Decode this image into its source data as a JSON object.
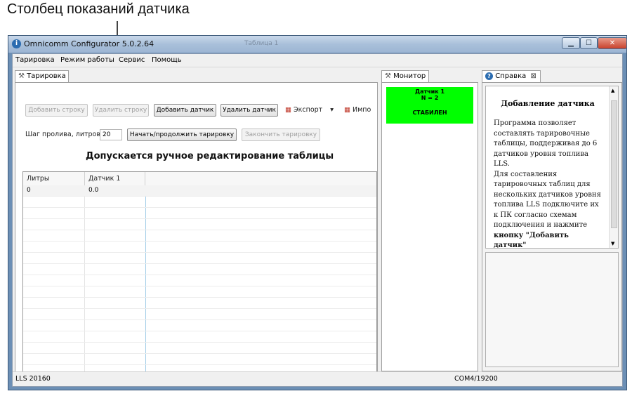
{
  "callout": "Столбец показаний датчика",
  "window": {
    "title": "Omnicomm Configurator 5.0.2.64",
    "ghost_title": "Таблица 1"
  },
  "menu": [
    "Тарировка",
    "Режим работы",
    "Сервис",
    "Помощь"
  ],
  "tarir_tab": "Тарировка",
  "toolbar": {
    "add_row": "Добавить строку",
    "delete_row": "Удалить строку",
    "add_sensor": "Добавить датчик",
    "delete_sensor": "Удалить датчик",
    "export": "Экспорт",
    "import": "Импо"
  },
  "pour_step": {
    "label": "Шаг пролива, литров",
    "value": "20",
    "start_button": "Начать/продолжить тарировку",
    "finish_button": "Закончить тарировку"
  },
  "table": {
    "caption": "Допускается ручное редактирование таблицы",
    "columns": [
      "Литры",
      "Датчик 1"
    ],
    "rows": [
      [
        "0",
        "0.0"
      ]
    ]
  },
  "monitor": {
    "tab": "Монитор",
    "sensor_name": "Датчик 1",
    "n_value": "N =   2",
    "status": "СТАБИЛЕН",
    "status_color": "#00ff00"
  },
  "help": {
    "tab": "Справка",
    "title": "Добавление датчика",
    "lines": [
      "Программа позволяет",
      "составлять тарировочные",
      "таблицы, поддерживая до 6",
      "датчиков уровня топлива",
      "LLS.",
      "Для составления",
      "тарировочных таблиц для",
      "нескольких датчиков уровня",
      "топлива LLS подключите их",
      "к ПК согласно схемам",
      "подключения и нажмите",
      "кнопку \"Добавить",
      "датчик\""
    ]
  },
  "status": {
    "left": "LLS 20160",
    "right": "COM4/19200"
  }
}
